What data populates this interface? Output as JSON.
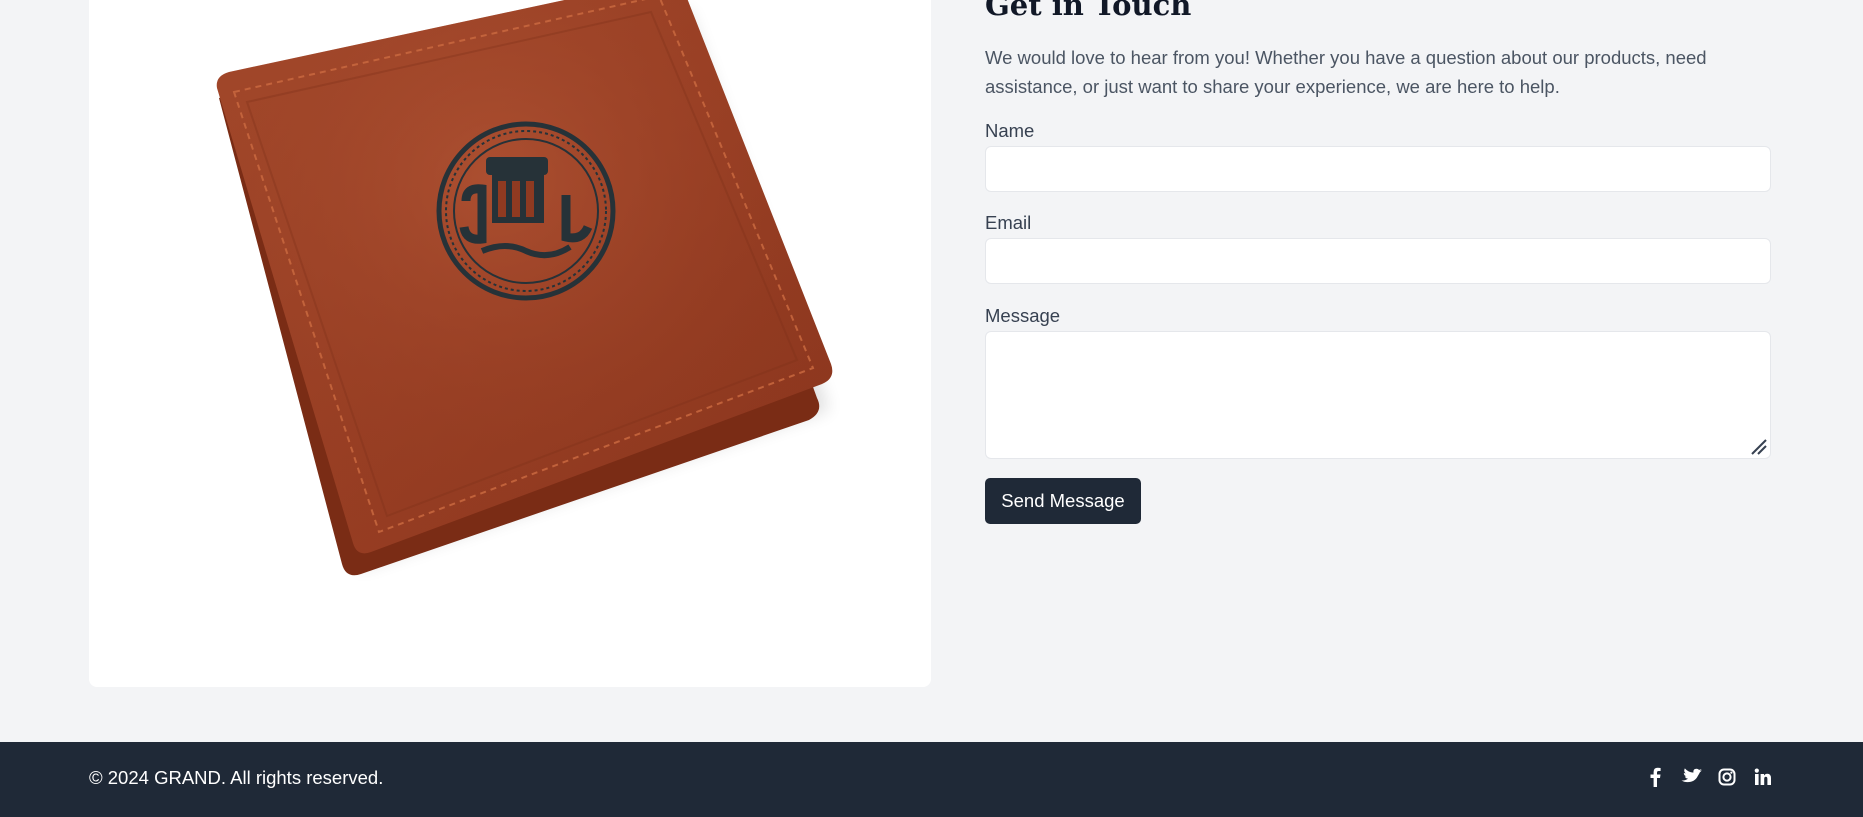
{
  "contact": {
    "title": "Get in Touch",
    "intro": "We would love to hear from you! Whether you have a question about our products, need assistance, or just want to share your experience, we are here to help.",
    "fields": {
      "name_label": "Name",
      "name_value": "",
      "email_label": "Email",
      "email_value": "",
      "message_label": "Message",
      "message_value": ""
    },
    "submit_label": "Send Message"
  },
  "product_image": {
    "description_icon": "leather-wallet-image",
    "leather_color": "#9b3f24",
    "emblem_color": "#263238"
  },
  "footer": {
    "copyright": "© 2024 GRAND. All rights reserved.",
    "social": [
      "facebook-icon",
      "twitter-icon",
      "instagram-icon",
      "linkedin-icon"
    ]
  },
  "colors": {
    "page_bg": "#f3f4f6",
    "footer_bg": "#1f2937",
    "button_bg": "#1f2937",
    "text": "#374151"
  }
}
